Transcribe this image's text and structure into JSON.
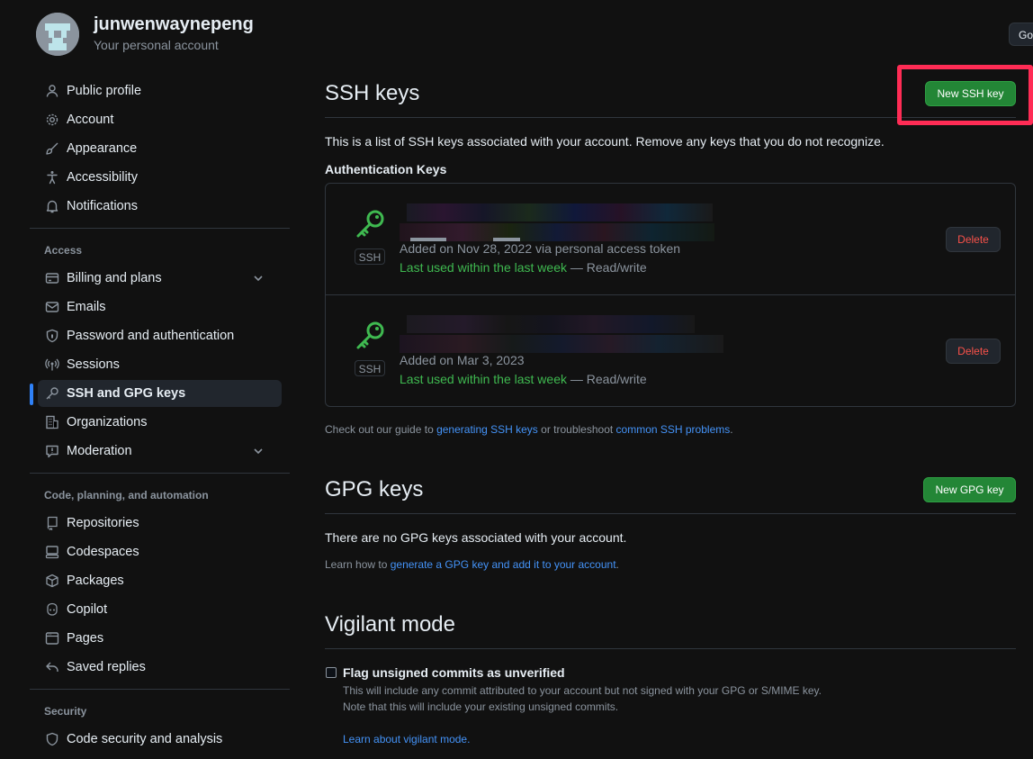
{
  "account": {
    "username": "junwenwaynepeng",
    "subtitle": "Your personal account",
    "goto_label": "Go"
  },
  "sidebar": {
    "top_items": [
      {
        "label": "Public profile",
        "icon": "person-icon"
      },
      {
        "label": "Account",
        "icon": "gear-icon"
      },
      {
        "label": "Appearance",
        "icon": "paintbrush-icon"
      },
      {
        "label": "Accessibility",
        "icon": "accessibility-icon"
      },
      {
        "label": "Notifications",
        "icon": "bell-icon"
      }
    ],
    "access_label": "Access",
    "access_items": [
      {
        "label": "Billing and plans",
        "icon": "credit-card-icon"
      },
      {
        "label": "Emails",
        "icon": "mail-icon"
      },
      {
        "label": "Password and authentication",
        "icon": "shield-lock-icon"
      },
      {
        "label": "Sessions",
        "icon": "broadcast-icon"
      },
      {
        "label": "SSH and GPG keys",
        "icon": "key-icon",
        "active": true
      },
      {
        "label": "Organizations",
        "icon": "organization-icon"
      },
      {
        "label": "Moderation",
        "icon": "report-icon"
      }
    ],
    "code_label": "Code, planning, and automation",
    "code_items": [
      {
        "label": "Repositories",
        "icon": "repo-icon"
      },
      {
        "label": "Codespaces",
        "icon": "codespaces-icon"
      },
      {
        "label": "Packages",
        "icon": "package-icon"
      },
      {
        "label": "Copilot",
        "icon": "copilot-icon"
      },
      {
        "label": "Pages",
        "icon": "browser-icon"
      },
      {
        "label": "Saved replies",
        "icon": "reply-icon"
      }
    ],
    "security_label": "Security",
    "security_items": [
      {
        "label": "Code security and analysis",
        "icon": "shield-icon"
      }
    ]
  },
  "ssh": {
    "title": "SSH keys",
    "new_button": "New SSH key",
    "description": "This is a list of SSH keys associated with your account. Remove any keys that you do not recognize.",
    "auth_heading": "Authentication Keys",
    "keys": [
      {
        "badge": "SSH",
        "added": "Added on Nov 28, 2022 via personal access token",
        "last_used": "Last used within the last week",
        "access": " — Read/write",
        "delete_label": "Delete"
      },
      {
        "badge": "SSH",
        "added": "Added on Mar 3, 2023",
        "last_used": "Last used within the last week",
        "access": " — Read/write",
        "delete_label": "Delete"
      }
    ],
    "guide_prefix": "Check out our guide to ",
    "guide_link1": "generating SSH keys",
    "guide_mid": " or troubleshoot ",
    "guide_link2": "common SSH problems",
    "guide_suffix": "."
  },
  "gpg": {
    "title": "GPG keys",
    "new_button": "New GPG key",
    "empty_text": "There are no GPG keys associated with your account.",
    "learn_prefix": "Learn how to ",
    "learn_link": "generate a GPG key and add it to your account",
    "learn_suffix": "."
  },
  "vigilant": {
    "title": "Vigilant mode",
    "checkbox_label": "Flag unsigned commits as unverified",
    "desc1": "This will include any commit attributed to your account but not signed with your GPG or S/MIME key.",
    "desc2": "Note that this will include your existing unsigned commits.",
    "learn_link": "Learn about vigilant mode."
  },
  "colors": {
    "background": "#111111",
    "accent_blue": "#4493f8",
    "green_button": "#238636",
    "highlight_red": "#ff2c55",
    "success_green": "#3fb950",
    "danger_red": "#f85149"
  }
}
